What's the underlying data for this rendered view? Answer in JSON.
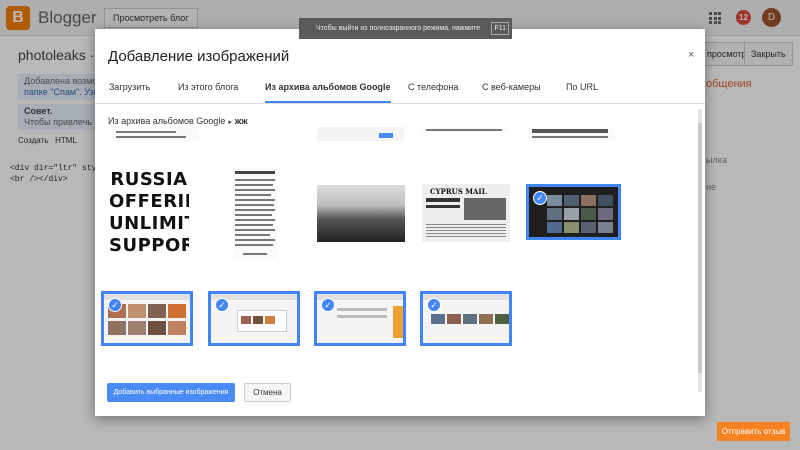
{
  "app": {
    "brand": "Blogger",
    "view_blog_button": "Просмотреть блог",
    "notifications_count": "12",
    "avatar_letter": "D",
    "fullscreen_hint": "Чтобы выйти из полноэкранного режима, нажмите",
    "fullscreen_key": "F11",
    "post_name": "photoleaks · Со",
    "preview_button": "просмотр",
    "close_button": "Закрыть",
    "info_text": "Добавлена возмож",
    "info_text2": "папке \"Спам\". Узнать",
    "tip_title": "Совет.",
    "tip_text": "Чтобы привлечь вн",
    "editor_tab_create": "Создать",
    "editor_tab_html": "HTML",
    "code_line1": "<div dir=\"ltr\" styl",
    "code_line2": "<br /></div>",
    "right_side_1": "общения",
    "right_side_2": "ылка",
    "right_side_3": "ие",
    "feedback_button": "Отправить отзыв"
  },
  "dialog": {
    "title": "Добавление изображений",
    "close_glyph": "×",
    "tabs": [
      {
        "label": "Загрузить",
        "active": false
      },
      {
        "label": "Из этого блога",
        "active": false
      },
      {
        "label": "Из архива альбомов Google",
        "active": true
      },
      {
        "label": "С телефона",
        "active": false
      },
      {
        "label": "С веб-камеры",
        "active": false
      },
      {
        "label": "По URL",
        "active": false
      }
    ],
    "breadcrumb": {
      "root": "Из архива альбомов Google",
      "separator": "▸",
      "album": "жж"
    },
    "russia_text": "RUSSIA OFFERING UNLIMITED SUPPORT’",
    "cyprus_masthead": "CYPRUS MAIL",
    "check_glyph": "✓",
    "add_button": "Добавить выбранные изображения",
    "cancel_button": "Отмена"
  },
  "thumbnails": [
    {
      "name": "partial-row-1",
      "selected": false
    },
    {
      "name": "partial-row-2",
      "selected": false
    },
    {
      "name": "partial-row-3",
      "selected": false
    },
    {
      "name": "partial-row-4",
      "selected": false
    },
    {
      "name": "russia-headline",
      "selected": false
    },
    {
      "name": "newspaper-column",
      "selected": false
    },
    {
      "name": "tanks-photo",
      "selected": false
    },
    {
      "name": "cyprus-mail",
      "selected": false
    },
    {
      "name": "dark-grid-screenshot",
      "selected": true
    },
    {
      "name": "photo-collage-screenshot",
      "selected": true
    },
    {
      "name": "web-screenshot-1",
      "selected": true
    },
    {
      "name": "web-screenshot-2",
      "selected": true
    },
    {
      "name": "web-screenshot-3",
      "selected": true
    }
  ]
}
